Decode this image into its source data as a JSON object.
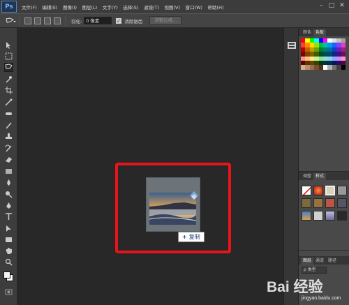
{
  "app": {
    "logo": "Ps"
  },
  "menu": [
    "文件(F)",
    "编辑(E)",
    "图像(I)",
    "图层(L)",
    "文字(Y)",
    "选择(S)",
    "滤镜(T)",
    "视图(V)",
    "窗口(W)",
    "帮助(H)"
  ],
  "window_controls": {
    "minimize": "–",
    "maximize": "□",
    "close": "✕"
  },
  "options": {
    "feather_label": "羽化:",
    "feather_value": "0 像素",
    "antialias_label": "消除锯齿",
    "refine_edge": "调整边缘..."
  },
  "panels": {
    "top_tabs": [
      "颜色",
      "色板"
    ],
    "mid_tabs": [
      "调整",
      "样式"
    ],
    "bottom_tabs": [
      "图层",
      "通道",
      "路径"
    ],
    "layers_filter": "类型"
  },
  "drag": {
    "copy_label": "复制",
    "plus": "+"
  },
  "watermark": {
    "main": "Bai 经验",
    "sub": "jingyan.baidu.com"
  },
  "colors": {
    "accent_red": "#e8141b",
    "panel_bg": "#494949",
    "canvas_bg": "#282828"
  }
}
